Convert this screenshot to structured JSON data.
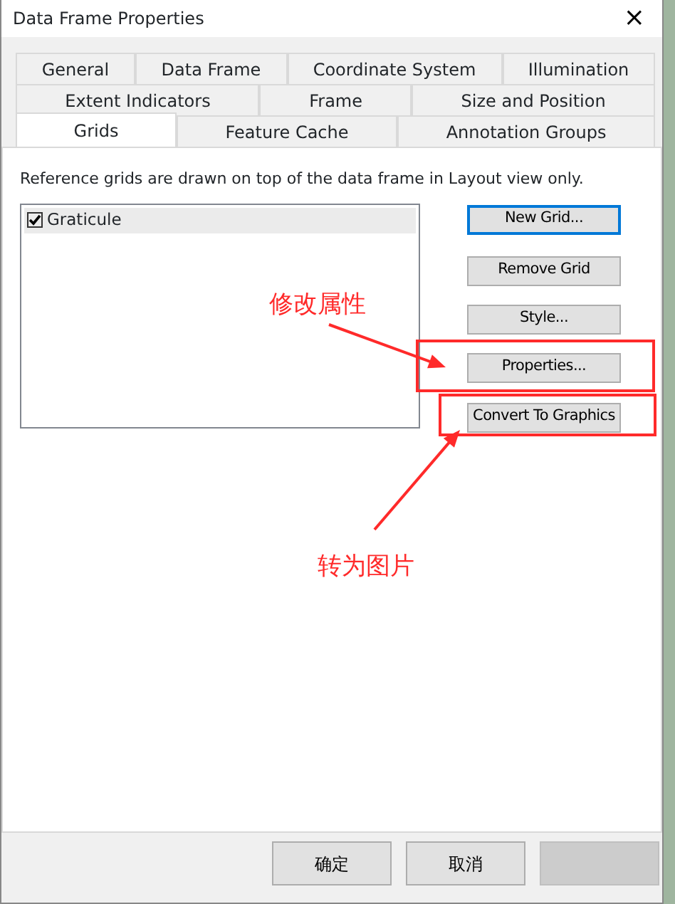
{
  "window": {
    "title": "Data Frame Properties",
    "close": "×"
  },
  "tab_rows": [
    [
      {
        "label": "General",
        "selected": false
      },
      {
        "label": "Data Frame",
        "selected": false
      },
      {
        "label": "Coordinate System",
        "selected": false
      },
      {
        "label": "Illumination",
        "selected": false
      }
    ],
    [
      {
        "label": "Extent Indicators",
        "selected": false
      },
      {
        "label": "Frame",
        "selected": false
      },
      {
        "label": "Size and Position",
        "selected": false
      }
    ],
    [
      {
        "label": "Grids",
        "selected": true
      },
      {
        "label": "Feature Cache",
        "selected": false
      },
      {
        "label": "Annotation Groups",
        "selected": false
      }
    ]
  ],
  "description": "Reference grids are drawn on top of the data frame in Layout view only.",
  "grids": [
    {
      "label": "Graticule",
      "checked": true,
      "selected": true
    }
  ],
  "side_buttons": [
    {
      "label": "New Grid...",
      "default": true
    },
    {
      "label": "Remove Grid",
      "default": false
    },
    {
      "label": "Style...",
      "default": false
    },
    {
      "label": "Properties...",
      "default": false
    },
    {
      "label": "Convert To Graphics",
      "default": false
    }
  ],
  "annotations": [
    {
      "text": "修改属性"
    },
    {
      "text": "转为图片"
    }
  ],
  "footer_buttons": [
    {
      "label": "确定",
      "disabled": false
    },
    {
      "label": "取消",
      "disabled": false
    },
    {
      "disabled": true
    }
  ]
}
